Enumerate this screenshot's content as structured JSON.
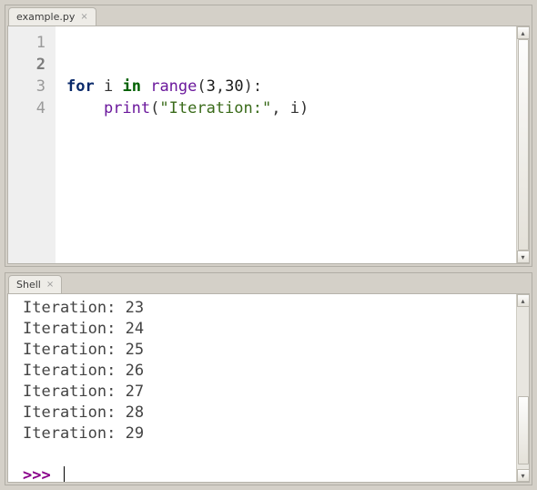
{
  "editor": {
    "tab_label": "example.py",
    "line_numbers": [
      "1",
      "2",
      "3",
      "4"
    ],
    "current_line_index": 1,
    "code": {
      "line1": "",
      "line2": "",
      "line3": {
        "kw_for": "for",
        "ident_i": "i",
        "kw_in": "in",
        "func_range": "range",
        "lparen": "(",
        "arg1": "3",
        "comma": ",",
        "arg2": "30",
        "rparen_colon": "):"
      },
      "line4": {
        "indent": "    ",
        "func_print": "print",
        "lparen": "(",
        "str": "\"Iteration:\"",
        "comma_sp": ", ",
        "ident_i": "i",
        "rparen": ")"
      }
    }
  },
  "shell": {
    "tab_label": "Shell",
    "lines": [
      "Iteration: 23",
      "Iteration: 24",
      "Iteration: 25",
      "Iteration: 26",
      "Iteration: 27",
      "Iteration: 28",
      "Iteration: 29"
    ],
    "prompt": ">>> "
  },
  "icons": {
    "tab_close": "×",
    "arrow_up": "▴",
    "arrow_down": "▾"
  }
}
